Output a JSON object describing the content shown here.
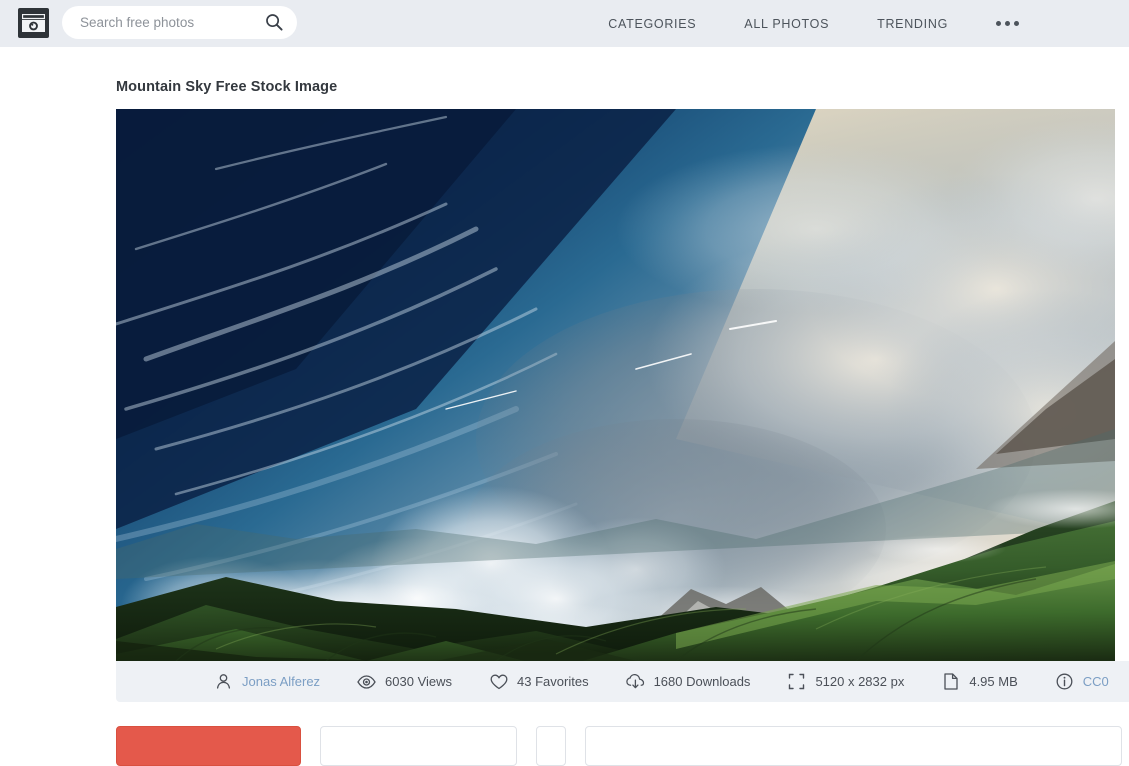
{
  "header": {
    "logo_icon": "camera-icon",
    "search": {
      "placeholder": "Search free photos",
      "value": "",
      "icon": "search-icon"
    },
    "nav": [
      {
        "label": "CATEGORIES"
      },
      {
        "label": "ALL PHOTOS"
      },
      {
        "label": "TRENDING"
      }
    ],
    "more_label": "more-options",
    "bg_color": "#e9ecf1"
  },
  "main": {
    "title": "Mountain Sky Free Stock Image",
    "photo": {
      "alt": "Mountain Sky Free Stock Image",
      "sky_blue": "#0e2c55",
      "cloud_white": "#e8eef4",
      "mountain_green": "#2f5a2a",
      "warm_cloud": "#e8cfae"
    },
    "meta": [
      {
        "icon": "user-icon",
        "label": "Jonas Alferez",
        "is_link": true
      },
      {
        "icon": "eye-icon",
        "label": "6030 Views",
        "is_link": false
      },
      {
        "icon": "heart-icon",
        "label": "43 Favorites",
        "is_link": false
      },
      {
        "icon": "download-icon",
        "label": "1680 Downloads",
        "is_link": false
      },
      {
        "icon": "dimensions-icon",
        "label": "5120 x 2832 px",
        "is_link": false
      },
      {
        "icon": "file-icon",
        "label": "4.95 MB",
        "is_link": false
      },
      {
        "icon": "info-icon",
        "label": "CC0",
        "is_link": true
      }
    ],
    "meta_bg": "#eef1f5",
    "link_color": "#7b9ec4"
  },
  "footer": {
    "download_button": "",
    "secondary_button": "",
    "icon_button": "",
    "wide_button": "",
    "primary_color": "#e4594b"
  }
}
